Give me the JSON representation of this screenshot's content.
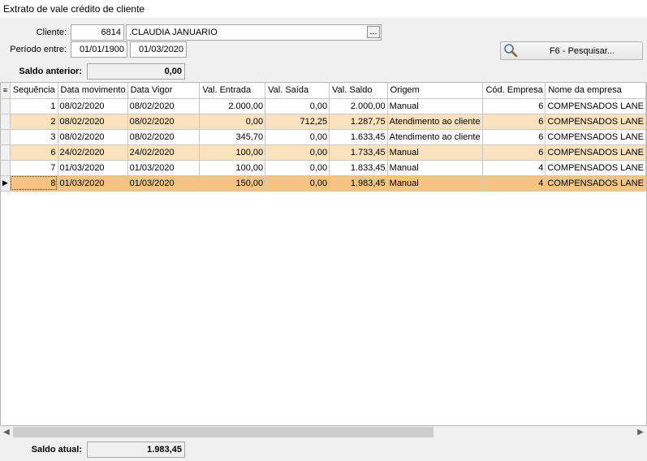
{
  "window": {
    "title": "Extrato de vale crédito de cliente"
  },
  "filters": {
    "cliente_label": "Cliente:",
    "cliente_codigo": "6814",
    "cliente_nome": ".CLAUDIA JANUARIO",
    "ellipsis": "...",
    "periodo_label": "Período entre:",
    "data_inicio": "01/01/1900",
    "data_fim": "01/03/2020",
    "search_label": "F6 - Pesquisar..."
  },
  "saldo_anterior": {
    "label": "Saldo anterior:",
    "value": "0,00"
  },
  "grid": {
    "columns": [
      "Sequência",
      "Data movimento",
      "Data Vigor",
      "Val. Entrada",
      "Val. Saída",
      "Val. Saldo",
      "Origem",
      "Cód. Empresa",
      "Nome da empresa"
    ],
    "rows": [
      {
        "seq": "1",
        "data_mov": "08/02/2020",
        "data_vigor": "08/02/2020",
        "entrada": "2.000,00",
        "saida": "0,00",
        "saldo": "2.000,00",
        "origem": "Manual",
        "cod_emp": "6",
        "empresa": "COMPENSADOS LANE"
      },
      {
        "seq": "2",
        "data_mov": "08/02/2020",
        "data_vigor": "08/02/2020",
        "entrada": "0,00",
        "saida": "712,25",
        "saldo": "1.287,75",
        "origem": "Atendimento ao cliente",
        "cod_emp": "6",
        "empresa": "COMPENSADOS LANE"
      },
      {
        "seq": "3",
        "data_mov": "08/02/2020",
        "data_vigor": "08/02/2020",
        "entrada": "345,70",
        "saida": "0,00",
        "saldo": "1.633,45",
        "origem": "Atendimento ao cliente",
        "cod_emp": "6",
        "empresa": "COMPENSADOS LANE"
      },
      {
        "seq": "6",
        "data_mov": "24/02/2020",
        "data_vigor": "24/02/2020",
        "entrada": "100,00",
        "saida": "0,00",
        "saldo": "1.733,45",
        "origem": "Manual",
        "cod_emp": "6",
        "empresa": "COMPENSADOS LANE"
      },
      {
        "seq": "7",
        "data_mov": "01/03/2020",
        "data_vigor": "01/03/2020",
        "entrada": "100,00",
        "saida": "0,00",
        "saldo": "1.833,45",
        "origem": "Manual",
        "cod_emp": "4",
        "empresa": "COMPENSADOS LANE"
      },
      {
        "seq": "8",
        "data_mov": "01/03/2020",
        "data_vigor": "01/03/2020",
        "entrada": "150,00",
        "saida": "0,00",
        "saldo": "1.983,45",
        "origem": "Manual",
        "cod_emp": "4",
        "empresa": "COMPENSADOS LANE"
      }
    ]
  },
  "saldo_atual": {
    "label": "Saldo atual:",
    "value": "1.983,45"
  },
  "colors": {
    "row_alt": "#f9e2bd",
    "row_selected": "#f5c47f"
  }
}
